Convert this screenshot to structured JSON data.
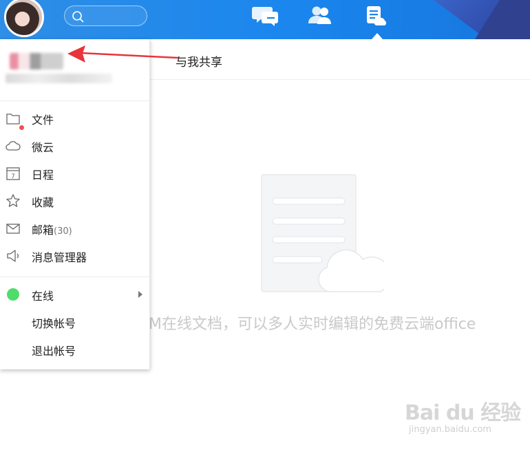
{
  "header": {
    "search": {
      "placeholder": ""
    },
    "nav": [
      "chat-bubbles-icon",
      "contacts-icon",
      "cloud-document-icon"
    ]
  },
  "main": {
    "share_tab": "与我共享",
    "empty_text": "M在线文档，可以多人实时编辑的免费云端office"
  },
  "menu": {
    "items": [
      {
        "label": "文件",
        "icon": "folder-icon"
      },
      {
        "label": "微云",
        "icon": "cloud-icon"
      },
      {
        "label": "日程",
        "icon": "calendar-icon",
        "icon_text": "7"
      },
      {
        "label": "收藏",
        "icon": "star-icon"
      },
      {
        "label": "邮箱",
        "count": "(30)",
        "icon": "mail-icon"
      },
      {
        "label": "消息管理器",
        "icon": "speaker-icon"
      }
    ],
    "status": {
      "label": "在线",
      "color": "#4fdc6a"
    },
    "switch_account": "切换帐号",
    "logout": "退出帐号"
  },
  "watermark": {
    "brand": "Bai du 经验",
    "domain": "jingyan.baidu.com"
  },
  "colors": {
    "topbar": "#1a86ee",
    "annotation_arrow": "#e8343a",
    "online": "#4fdc6a",
    "badge": "#f05050"
  }
}
